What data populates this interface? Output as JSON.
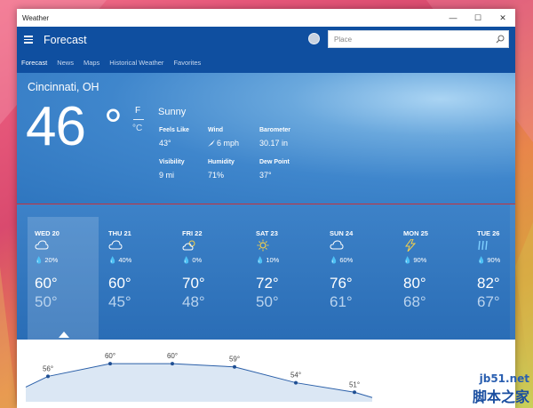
{
  "window": {
    "title": "Weather"
  },
  "window_controls": {
    "minimize": "—",
    "maximize": "☐",
    "close": "✕"
  },
  "appbar": {
    "title": "Forecast"
  },
  "search": {
    "placeholder": "Place"
  },
  "tabs": [
    {
      "label": "Forecast",
      "active": true
    },
    {
      "label": "News",
      "active": false
    },
    {
      "label": "Maps",
      "active": false
    },
    {
      "label": "Historical Weather",
      "active": false
    },
    {
      "label": "Favorites",
      "active": false
    }
  ],
  "current": {
    "city": "Cincinnati, OH",
    "temperature": "46",
    "degree": "°",
    "unit_f": "F",
    "unit_c": "°C",
    "condition": "Sunny",
    "details": [
      {
        "label": "Feels Like",
        "value": "43°"
      },
      {
        "label": "Wind",
        "value": "6 mph"
      },
      {
        "label": "Barometer",
        "value": "30.17 in"
      },
      {
        "label": "Visibility",
        "value": "9 mi"
      },
      {
        "label": "Humidity",
        "value": "71%"
      },
      {
        "label": "Dew Point",
        "value": "37°"
      }
    ]
  },
  "forecast": [
    {
      "day": "WED 20",
      "icon": "cloudy-icon",
      "precip": "20%",
      "high": "60°",
      "low": "50°",
      "selected": true
    },
    {
      "day": "THU 21",
      "icon": "cloudy-icon",
      "precip": "40%",
      "high": "60°",
      "low": "45°",
      "selected": false
    },
    {
      "day": "FRI 22",
      "icon": "partly-cloudy-icon",
      "precip": "0%",
      "high": "70°",
      "low": "48°",
      "selected": false
    },
    {
      "day": "SAT 23",
      "icon": "sunny-icon",
      "precip": "10%",
      "high": "72°",
      "low": "50°",
      "selected": false
    },
    {
      "day": "SUN 24",
      "icon": "cloudy-icon",
      "precip": "60%",
      "high": "76°",
      "low": "61°",
      "selected": false
    },
    {
      "day": "MON 25",
      "icon": "thunderstorm-icon",
      "precip": "90%",
      "high": "80°",
      "low": "68°",
      "selected": false
    },
    {
      "day": "TUE 26",
      "icon": "rain-icon",
      "precip": "90%",
      "high": "82°",
      "low": "67°",
      "selected": false
    }
  ],
  "hourly_graph": {
    "values": [
      56,
      60,
      60,
      59,
      54,
      51
    ],
    "labels": [
      "56°",
      "60°",
      "60°",
      "59°",
      "54°",
      "51°"
    ]
  },
  "watermark": {
    "url": "jb51.net",
    "text": "脚本之家"
  },
  "colors": {
    "appbar": "#0f4fa0",
    "hero": "#3f86cc",
    "accent_line": "#c8323a"
  }
}
